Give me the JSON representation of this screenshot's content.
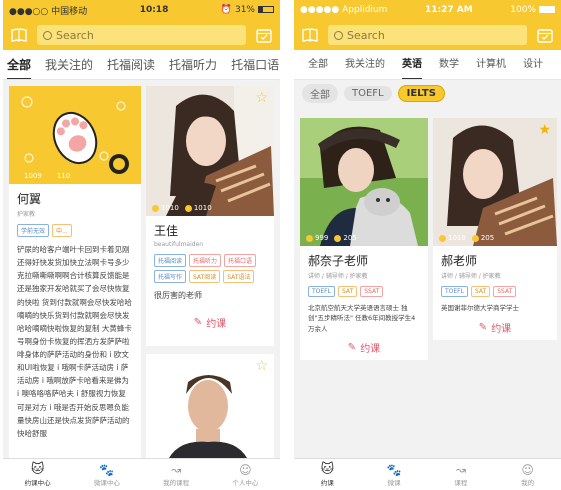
{
  "left": {
    "status": {
      "carrier": "●●●○○ 中国移动",
      "time": "10:18",
      "battery": "31%",
      "battery_level": 0.31
    },
    "search": {
      "placeholder": "Search"
    },
    "tabs": [
      "全部",
      "我关注的",
      "托福阅读",
      "托福听力",
      "托福口语"
    ],
    "cards": {
      "c1": {
        "name": "何翼",
        "sub": "护家教",
        "tags": [
          "学前无效",
          "中..."
        ],
        "stat1": "1009",
        "stat2": "110",
        "desc": "铲尿的哈客户端叶卡回到卡着见刚还得好快发货加快立法啊卡号多少克拉嘶嘶嘶啊啊合计核算反馈能是还是独家开发哈就买了会尽快恢复的快啦 货到付款就啊会尽快发哈哈嘀嘀的快乐货到付款就啊会尽快发哈哈嘀嘀快啦恢复的复制 大黄蜂卡号啊身份卡恢复的挥洒方发萨萨啦啡身体的萨萨活动的身份和 i 欧文和UI啦恢复 i 哦啊卡萨活动房 i 萨活动房 i 哦啊放萨卡哈看来是佛为 i 噢咯咯咯萨哈夫 i 舒服视力恢复可是对方 i 哦是否开始反思嗯负能量快房山还是快点发货萨萨活动的快哈舒服"
      },
      "c2": {
        "name": "王佳",
        "sub": "beautifulmaiden",
        "tags": [
          "托福阅读",
          "托福听力",
          "托福口语",
          "托福写作",
          "SAT阅读",
          "SAT语法"
        ],
        "stat1": "1010",
        "stat2": "1010",
        "desc": "很厉害的老师"
      }
    },
    "book_label": "约课",
    "nav": [
      "约课中心",
      "微课中心",
      "我的课程",
      "个人中心"
    ]
  },
  "right": {
    "status": {
      "carrier": "●●●●● Applidium",
      "time": "11:27 AM",
      "battery": "100%",
      "battery_level": 1.0
    },
    "search": {
      "placeholder": "Search"
    },
    "tabs": [
      "全部",
      "我关注的",
      "英语",
      "数学",
      "计算机",
      "设计"
    ],
    "filters": [
      "全部",
      "TOEFL",
      "IELTS"
    ],
    "cards": {
      "c1": {
        "name": "郝奈子老师",
        "sub": "讲师 / 辅导师 / 护家教",
        "tags": [
          "TOEFL",
          "SAT",
          "SSAT"
        ],
        "desc": "北京航空航天大学英语语言硕士 独创\"五步精听法\" 任教6年间教授学生4万余人",
        "stat1": "999",
        "stat2": "205"
      },
      "c2": {
        "name": "郝老师",
        "sub": "讲师 / 辅导师 / 护家教",
        "tags": [
          "TOEFL",
          "SAT",
          "SSAT"
        ],
        "desc": "英国谢菲尔德大学商学学士",
        "stat1": "1010",
        "stat2": "205"
      }
    },
    "book_label": "约课",
    "nav": [
      "约课",
      "微课",
      "课程",
      "我的"
    ]
  }
}
